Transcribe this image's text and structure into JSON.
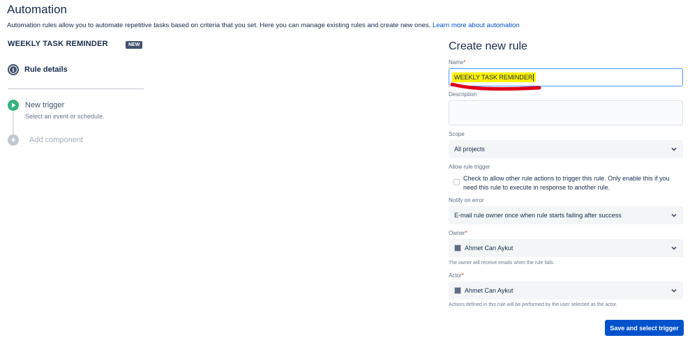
{
  "page": {
    "title": "Automation",
    "intro": "Automation rules allow you to automate repetitive tasks based on criteria that you set. Here you can manage existing rules and create new ones.",
    "learn_more": "Learn more about automation"
  },
  "rule": {
    "name": "WEEKLY TASK REMINDER",
    "badge": "NEW",
    "steps": {
      "rule_details": "Rule details",
      "new_trigger": "New trigger",
      "new_trigger_sub": "Select an event or schedule.",
      "add_component": "Add component"
    }
  },
  "form": {
    "title": "Create new rule",
    "name_label": "Name",
    "name_value": "WEEKLY TASK REMINDER",
    "description_label": "Description",
    "scope_label": "Scope",
    "scope_value": "All projects",
    "allow_trigger_label": "Allow rule trigger",
    "allow_trigger_text": "Check to allow other rule actions to trigger this rule. Only enable this if you need this rule to execute in response to another rule.",
    "notify_label": "Notify on error",
    "notify_value": "E-mail rule owner once when rule starts failing after success",
    "owner_label": "Owner",
    "owner_value": "Ahmet Can Aykut",
    "owner_help": "The owner will receive emails when the rule fails.",
    "actor_label": "Actor",
    "actor_value": "Ahmet Can Aykut",
    "actor_help": "Actions defined in this rule will be performed by the user selected as the actor.",
    "required_marker": "*",
    "submit_label": "Save and select trigger"
  },
  "colors": {
    "primary": "#0052cc",
    "trigger_green": "#36b37e",
    "highlight_yellow": "#fff200",
    "annotation_red": "#e0001b"
  }
}
